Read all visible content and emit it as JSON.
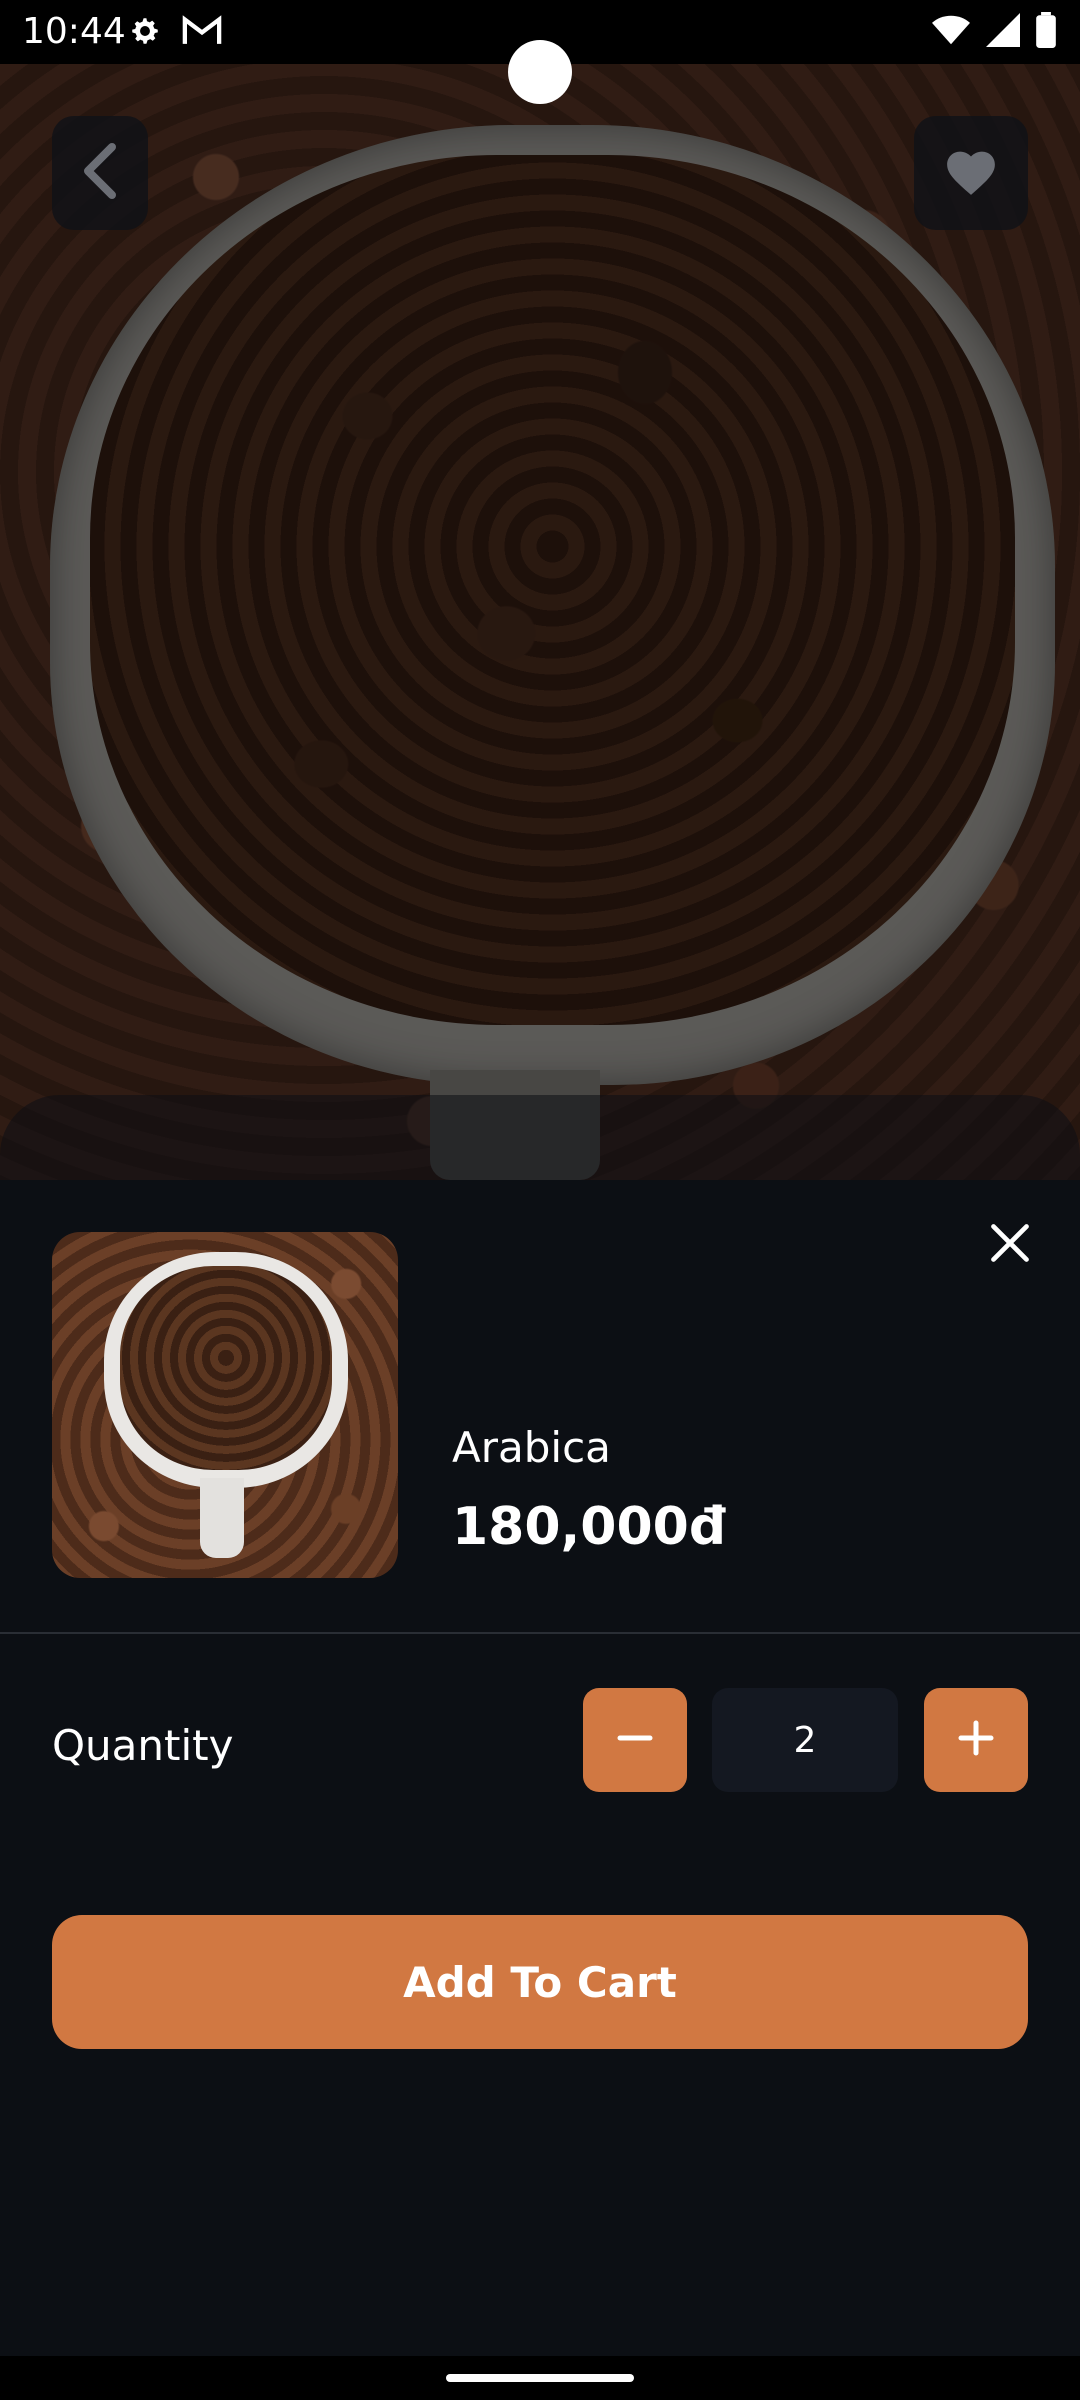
{
  "status_bar": {
    "time": "10:44",
    "icons_left": [
      "settings-icon",
      "gmail-icon"
    ],
    "icons_right": [
      "wifi-icon",
      "signal-icon",
      "battery-icon"
    ]
  },
  "hero": {
    "image": "coffee-beans-bowl-photo",
    "back_icon": "chevron-left-icon",
    "favorite_icon": "heart-icon"
  },
  "product": {
    "name": "Arabica",
    "price": "180,000đ"
  },
  "quantity": {
    "label": "Quantity",
    "value": "2",
    "minus_icon": "minus-icon",
    "plus_icon": "plus-icon"
  },
  "cart": {
    "add_label": "Add To Cart"
  },
  "colors": {
    "accent": "#d17842",
    "background": "#0c0f14",
    "field": "#141821"
  }
}
